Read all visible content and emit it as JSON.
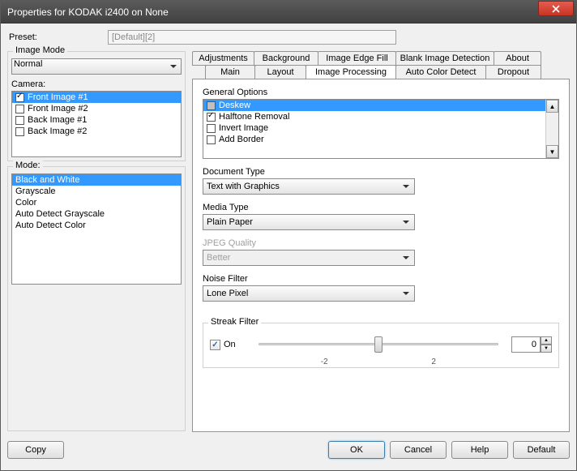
{
  "window": {
    "title": "Properties for KODAK i2400 on None"
  },
  "preset": {
    "label": "Preset:",
    "value": "[Default][2]"
  },
  "image_mode": {
    "label": "Image Mode",
    "value": "Normal"
  },
  "camera": {
    "label": "Camera:",
    "items": [
      {
        "label": "Front Image #1",
        "checked": true,
        "selected": true
      },
      {
        "label": "Front Image #2",
        "checked": false,
        "selected": false
      },
      {
        "label": "Back Image #1",
        "checked": false,
        "selected": false
      },
      {
        "label": "Back Image #2",
        "checked": false,
        "selected": false
      }
    ]
  },
  "mode": {
    "label": "Mode:",
    "items": [
      {
        "label": "Black and White",
        "selected": true
      },
      {
        "label": "Grayscale",
        "selected": false
      },
      {
        "label": "Color",
        "selected": false
      },
      {
        "label": "Auto Detect Grayscale",
        "selected": false
      },
      {
        "label": "Auto Detect Color",
        "selected": false
      }
    ]
  },
  "tabs_row1": [
    "Adjustments",
    "Background",
    "Image Edge Fill",
    "Blank Image Detection",
    "About"
  ],
  "tabs_row2": [
    "Main",
    "Layout",
    "Image Processing",
    "Auto Color Detect",
    "Dropout"
  ],
  "active_tab": "Image Processing",
  "general_options": {
    "label": "General Options",
    "items": [
      {
        "label": "Deskew",
        "checked_state": "grey",
        "selected": true
      },
      {
        "label": "Halftone Removal",
        "checked_state": "checked",
        "selected": false
      },
      {
        "label": "Invert Image",
        "checked_state": "unchecked",
        "selected": false
      },
      {
        "label": "Add Border",
        "checked_state": "unchecked",
        "selected": false
      }
    ]
  },
  "document_type": {
    "label": "Document Type",
    "value": "Text with Graphics"
  },
  "media_type": {
    "label": "Media Type",
    "value": "Plain Paper"
  },
  "jpeg_quality": {
    "label": "JPEG Quality",
    "value": "Better",
    "disabled": true
  },
  "noise_filter": {
    "label": "Noise Filter",
    "value": "Lone Pixel"
  },
  "streak_filter": {
    "label": "Streak Filter",
    "on_label": "On",
    "on": true,
    "value": "0",
    "ticks": [
      "-2",
      "2"
    ]
  },
  "buttons": {
    "copy": "Copy",
    "ok": "OK",
    "cancel": "Cancel",
    "help": "Help",
    "default": "Default"
  }
}
